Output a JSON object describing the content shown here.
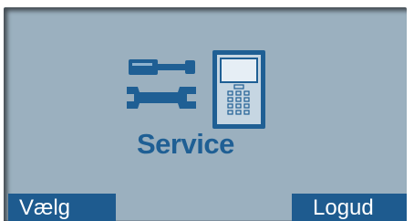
{
  "screen": {
    "background_color": "#9bb0bf",
    "accent_color": "#1e5b8f"
  },
  "service_panel": {
    "icons": [
      "screwdriver-icon",
      "wrench-icon",
      "keypad-device-icon"
    ],
    "label": "Service"
  },
  "softkeys": {
    "left_label": "Vælg",
    "right_label": "Logud"
  }
}
